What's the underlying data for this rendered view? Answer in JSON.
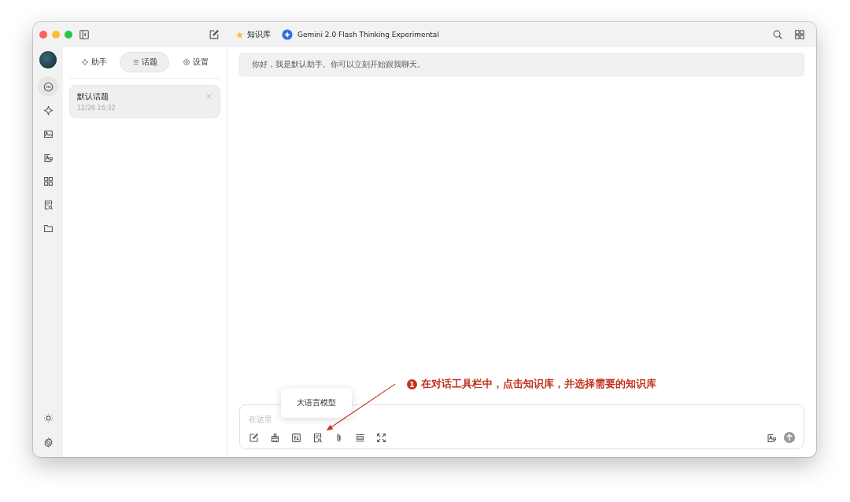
{
  "title_bar": {
    "knowledge_base": "知识库",
    "model": "Gemini 2.0 Flash Thinking Experimental"
  },
  "rail": [
    {
      "kind": "chat",
      "selected": true
    },
    {
      "kind": "sparkle",
      "selected": false
    },
    {
      "kind": "image",
      "selected": false
    },
    {
      "kind": "translate",
      "selected": false
    },
    {
      "kind": "apps",
      "selected": false
    },
    {
      "kind": "document",
      "selected": false
    },
    {
      "kind": "folder",
      "selected": false
    }
  ],
  "tabs": [
    {
      "kind": "assistant",
      "label": "助手",
      "selected": false
    },
    {
      "kind": "list",
      "label": "话题",
      "selected": true
    },
    {
      "kind": "settings",
      "label": "设置",
      "selected": false
    }
  ],
  "topics": [
    {
      "title": "默认话题",
      "time": "12/26 16:32",
      "selected": true
    }
  ],
  "messages": [
    {
      "text": "你好，我是默认助手。你可以立刻开始跟我聊天。"
    }
  ],
  "composer": {
    "placeholder": "在这里",
    "tools": [
      {
        "kind": "edit"
      },
      {
        "kind": "broom"
      },
      {
        "kind": "sliders"
      },
      {
        "kind": "knowledge"
      },
      {
        "kind": "attach"
      },
      {
        "kind": "divider"
      },
      {
        "kind": "expand"
      }
    ],
    "tooltip": "大语言模型"
  },
  "annotation": {
    "number": "1",
    "text": "在对话工具栏中，点击知识库，并选择需要的知识库"
  }
}
